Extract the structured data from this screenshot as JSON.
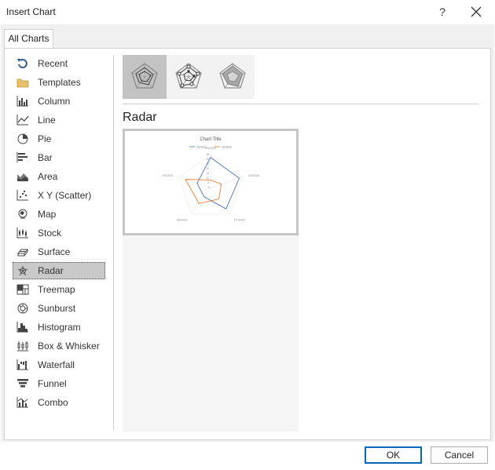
{
  "dialog": {
    "title": "Insert Chart",
    "help_label": "?"
  },
  "tabs": [
    {
      "label": "All Charts"
    }
  ],
  "sidebar": {
    "items": [
      {
        "label": "Recent",
        "icon": "recent-icon"
      },
      {
        "label": "Templates",
        "icon": "folder-icon"
      },
      {
        "label": "Column",
        "icon": "column-chart-icon"
      },
      {
        "label": "Line",
        "icon": "line-chart-icon"
      },
      {
        "label": "Pie",
        "icon": "pie-chart-icon"
      },
      {
        "label": "Bar",
        "icon": "bar-chart-icon"
      },
      {
        "label": "Area",
        "icon": "area-chart-icon"
      },
      {
        "label": "X Y (Scatter)",
        "icon": "scatter-chart-icon"
      },
      {
        "label": "Map",
        "icon": "map-chart-icon"
      },
      {
        "label": "Stock",
        "icon": "stock-chart-icon"
      },
      {
        "label": "Surface",
        "icon": "surface-chart-icon"
      },
      {
        "label": "Radar",
        "icon": "radar-chart-icon",
        "selected": true
      },
      {
        "label": "Treemap",
        "icon": "treemap-chart-icon"
      },
      {
        "label": "Sunburst",
        "icon": "sunburst-chart-icon"
      },
      {
        "label": "Histogram",
        "icon": "histogram-chart-icon"
      },
      {
        "label": "Box & Whisker",
        "icon": "box-whisker-chart-icon"
      },
      {
        "label": "Waterfall",
        "icon": "waterfall-chart-icon"
      },
      {
        "label": "Funnel",
        "icon": "funnel-chart-icon"
      },
      {
        "label": "Combo",
        "icon": "combo-chart-icon"
      }
    ]
  },
  "subtypes": [
    {
      "icon": "radar-subtype-icon",
      "selected": true
    },
    {
      "icon": "radar-with-markers-subtype-icon",
      "selected": false
    },
    {
      "icon": "filled-radar-subtype-icon",
      "selected": false
    }
  ],
  "subtype_title": "Radar",
  "preview": {
    "chart_title": "Chart Title",
    "legend": [
      "Series1",
      "Series2"
    ],
    "category_labels": [
      "1/5/2020",
      "1/6/2020",
      "1/7/2020",
      "1/8/2020",
      "1/9/2020"
    ],
    "axis_ticks": [
      "35",
      "30",
      "25",
      "20",
      "15",
      "10",
      "5",
      "0"
    ],
    "series_colors": [
      "#4472c4",
      "#ed7d31"
    ]
  },
  "chart_data": {
    "type": "radar",
    "title": "Chart Title",
    "categories": [
      "1/5/2020",
      "1/6/2020",
      "1/7/2020",
      "1/8/2020",
      "1/9/2020"
    ],
    "rlim": [
      0,
      35
    ],
    "series": [
      {
        "name": "Series1",
        "values": [
          32,
          32,
          28,
          12,
          15
        ]
      },
      {
        "name": "Series2",
        "values": [
          8,
          12,
          15,
          21,
          28
        ]
      }
    ],
    "legend_position": "top"
  },
  "buttons": {
    "ok": "OK",
    "cancel": "Cancel"
  }
}
